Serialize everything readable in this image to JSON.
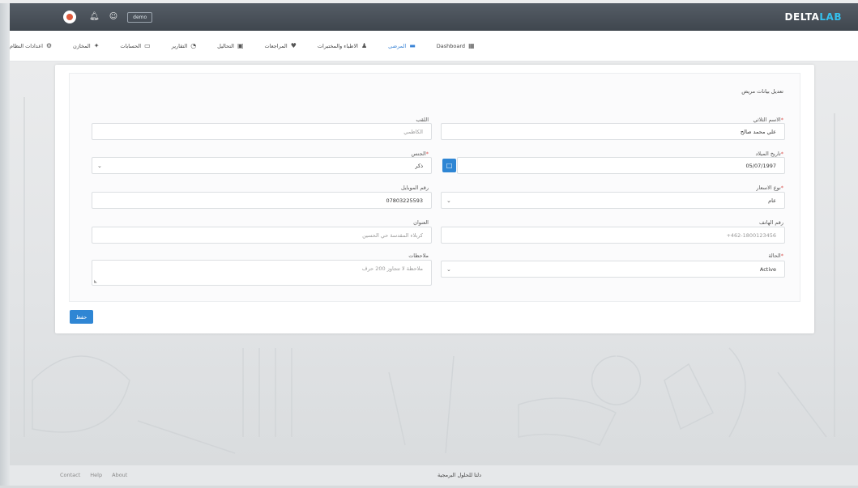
{
  "topbar": {
    "brand_main": "DELTA",
    "brand_accent": "LAB",
    "user": "demo",
    "icons": [
      "logo-icon",
      "bell-icon",
      "user-icon"
    ]
  },
  "nav": {
    "items": [
      {
        "label": "Dashboard",
        "icon": "dashboard-icon"
      },
      {
        "label": "المرضى",
        "icon": "bed-icon",
        "active": true
      },
      {
        "label": "الاطباء والمختبرات",
        "icon": "doctor-icon"
      },
      {
        "label": "المراجعات",
        "icon": "heart-icon"
      },
      {
        "label": "التحاليل",
        "icon": "briefcase-icon"
      },
      {
        "label": "التقارير",
        "icon": "pie-chart-icon"
      },
      {
        "label": "الحسابات",
        "icon": "money-icon"
      },
      {
        "label": "المخازن",
        "icon": "handshake-icon"
      },
      {
        "label": "اعدادات النظام",
        "icon": "gear-icon"
      }
    ]
  },
  "form": {
    "title": "تعديل بيانات مريض",
    "full_name": {
      "label": "الاسم الثلاثي",
      "value": "علي محمد صالح"
    },
    "surname": {
      "label": "اللقب",
      "placeholder": "الكاظمي"
    },
    "birth_date": {
      "label": "تاريخ الميلاد",
      "value": "05/07/1997"
    },
    "gender": {
      "label": "الجنس",
      "value": "ذكر"
    },
    "price_type": {
      "label": "نوع الاسعار",
      "value": "عام"
    },
    "mobile": {
      "label": "رقم الموبايل",
      "value": "07803225593"
    },
    "phone": {
      "label": "رقم الهاتف",
      "placeholder": "+462-1800123456"
    },
    "address": {
      "label": "العنوان",
      "placeholder": "كربلاء المقدسة حي الحسين"
    },
    "status": {
      "label": "الحالة",
      "value": "Active"
    },
    "notes": {
      "label": "ملاحظات",
      "placeholder": "ملاحظة لا تتجاوز 200 حرف"
    },
    "save_label": "حفظ"
  },
  "footer": {
    "links": [
      "Contact",
      "Help",
      "About"
    ],
    "center_text": "دلتا للحلول البرمجية"
  },
  "colors": {
    "accent": "#2f86d4",
    "topbar": "#474e56",
    "brand_accent": "#35c1ee",
    "required": "#d9534f"
  }
}
